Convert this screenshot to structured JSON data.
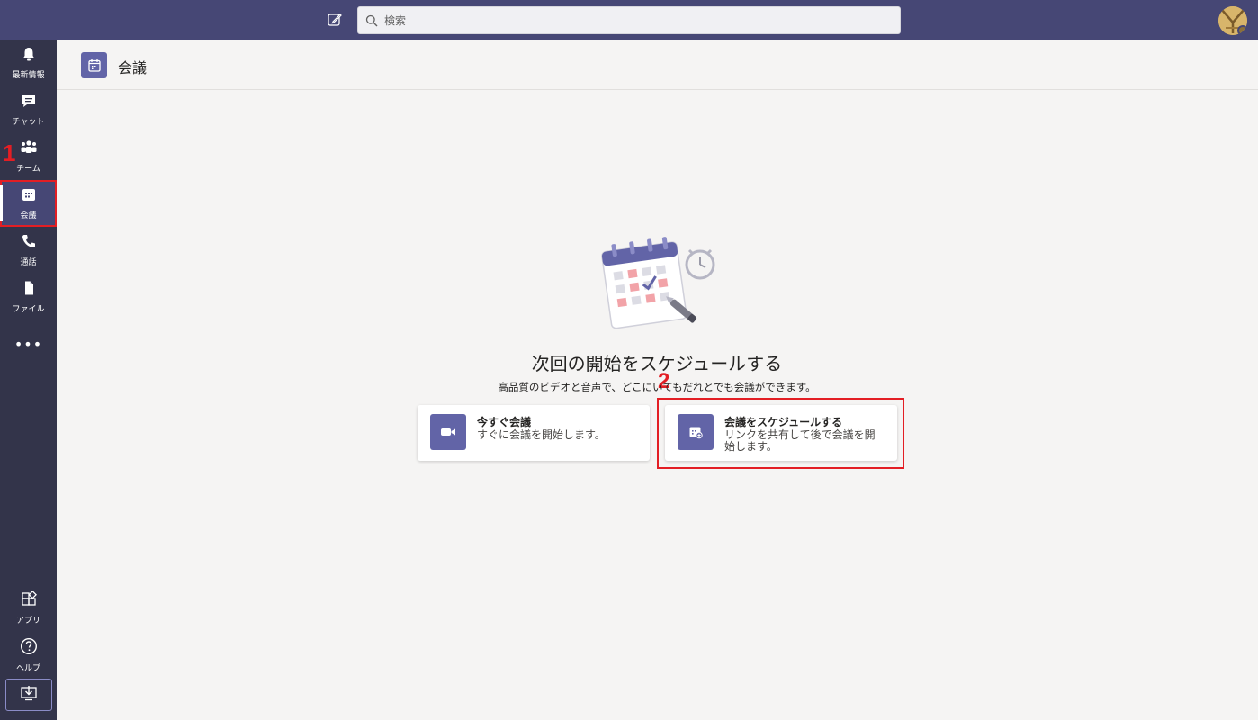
{
  "topbar": {
    "search_placeholder": "検索",
    "compose_icon": "compose-icon",
    "search_icon": "search-icon"
  },
  "sidebar": {
    "items": [
      {
        "label": "最新情報",
        "icon": "bell-icon"
      },
      {
        "label": "チャット",
        "icon": "chat-icon"
      },
      {
        "label": "チーム",
        "icon": "teams-icon"
      },
      {
        "label": "会議",
        "icon": "calendar-icon",
        "active": true
      },
      {
        "label": "通話",
        "icon": "phone-icon"
      },
      {
        "label": "ファイル",
        "icon": "file-icon"
      }
    ],
    "more": "•••",
    "apps_label": "アプリ",
    "help_label": "ヘルプ"
  },
  "annotations": {
    "step1": "1",
    "step2": "2"
  },
  "header": {
    "title": "会議"
  },
  "main": {
    "title": "次回の開始をスケジュールする",
    "subtitle": "高品質のビデオと音声で、どこにいてもだれとでも会議ができます。"
  },
  "cards": {
    "meet_now": {
      "title": "今すぐ会議",
      "desc": "すぐに会議を開始します。"
    },
    "schedule": {
      "title": "会議をスケジュールする",
      "desc": "リンクを共有して後で会議を開始します。"
    }
  },
  "colors": {
    "topbar": "#464775",
    "sidebar": "#33344a",
    "accent": "#6264a7",
    "annotation": "#e31e24"
  }
}
